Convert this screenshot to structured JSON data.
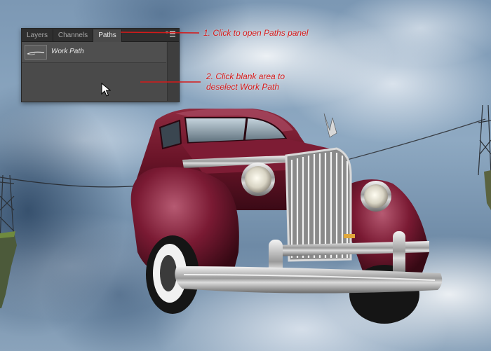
{
  "panel": {
    "tabs": [
      {
        "label": "Layers",
        "active": false
      },
      {
        "label": "Channels",
        "active": false
      },
      {
        "label": "Paths",
        "active": true
      }
    ],
    "menu_icon": "panel-menu-icon",
    "path_items": [
      {
        "name": "Work Path",
        "icon": "path-thumbnail-icon"
      }
    ]
  },
  "annotations": {
    "step1": "1. Click to open Paths panel",
    "step2_line1": "2. Click blank area to",
    "step2_line2": "deselect Work Path",
    "color": "#d51a1a"
  },
  "cursor_icon": "arrow-cursor-icon"
}
